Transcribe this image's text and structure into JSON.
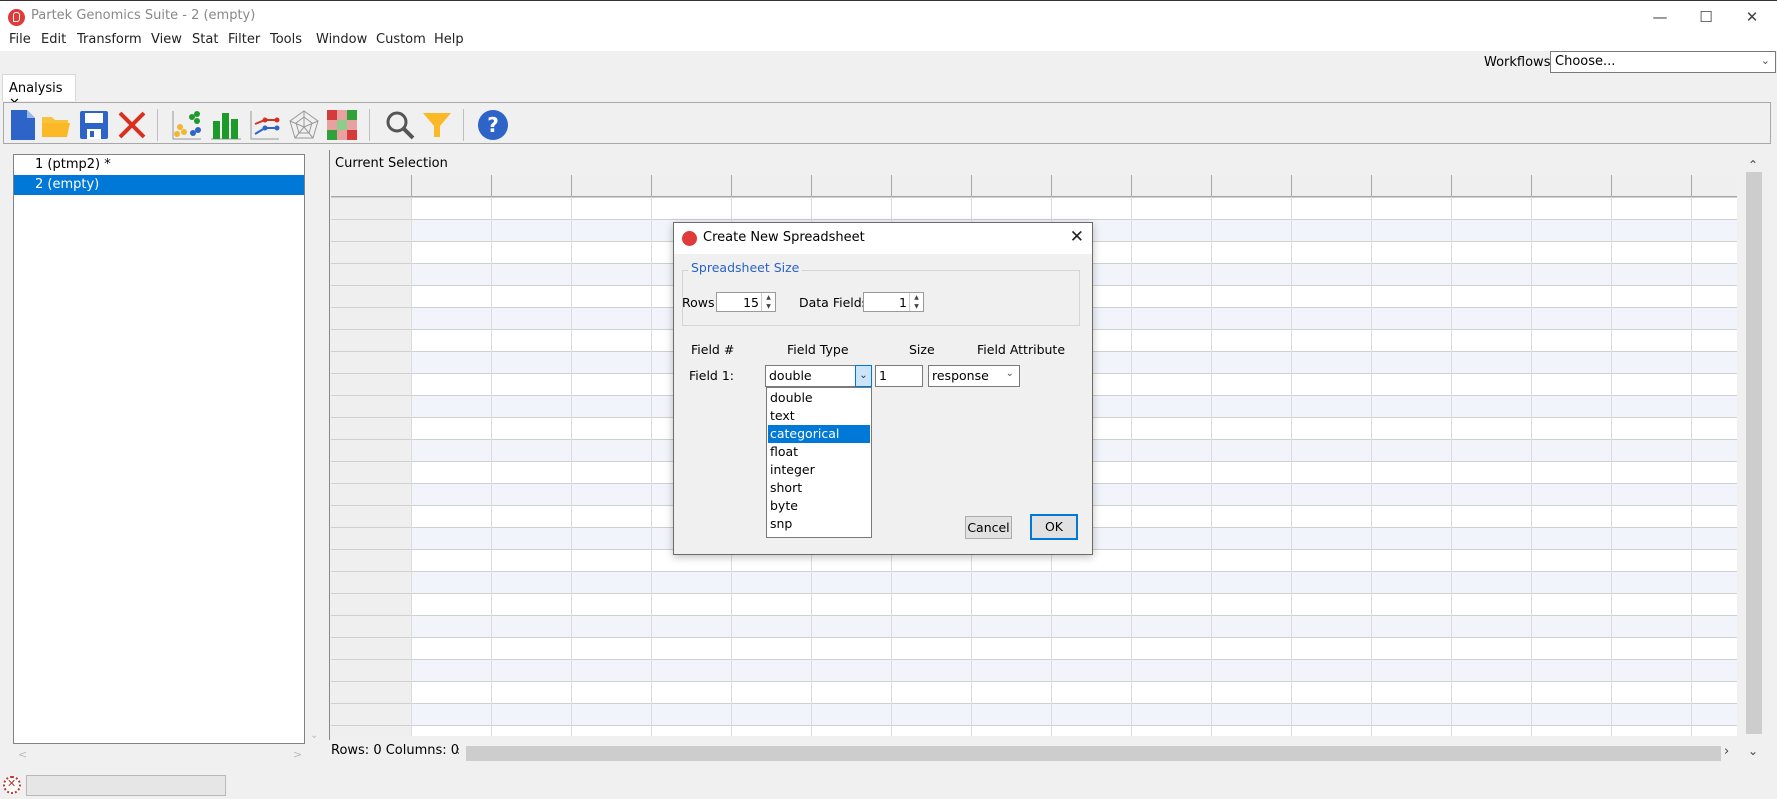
{
  "window": {
    "title": "Partek Genomics Suite - 2 (empty)",
    "controls": {
      "minimize": "—",
      "maximize": "☐",
      "close": "✕"
    }
  },
  "menubar": [
    "File",
    "Edit",
    "Transform",
    "View",
    "Stat",
    "Filter",
    "Tools",
    "Window",
    "Custom",
    "Help"
  ],
  "workflows": {
    "label": "Workflows",
    "selected": "Choose..."
  },
  "tab": {
    "label": "Analysis",
    "close": "✕"
  },
  "toolbar": {
    "icons": [
      "new-file-icon",
      "open-folder-icon",
      "save-icon",
      "delete-icon",
      "scatter-plot-icon",
      "bar-chart-icon",
      "line-chart-icon",
      "radar-chart-icon",
      "heatmap-icon",
      "search-icon",
      "filter-icon",
      "help-icon"
    ]
  },
  "spreadsheet_list": {
    "items": [
      {
        "label": "1 (ptmp2) *",
        "selected": false
      },
      {
        "label": "2 (empty)",
        "selected": true
      }
    ]
  },
  "grid": {
    "title": "Current Selection",
    "status": "Rows: 0 Columns: 0"
  },
  "colors": {
    "accent": "#0078d7",
    "group_title": "#2a62c9",
    "row_band": "#f1f5fb"
  },
  "dialog": {
    "title": "Create New Spreadsheet",
    "close": "✕",
    "group_title": "Spreadsheet Size",
    "rows_label": "Rows",
    "rows_value": "15",
    "data_fields_label": "Data Fields",
    "data_fields_value": "1",
    "headers": {
      "field_num": "Field #",
      "field_type": "Field Type",
      "size": "Size",
      "field_attribute": "Field Attribute"
    },
    "field_row": {
      "label": "Field 1:",
      "type": "double",
      "size": "1",
      "attribute": "response"
    },
    "type_options": [
      {
        "label": "double",
        "highlighted": false
      },
      {
        "label": "text",
        "highlighted": false
      },
      {
        "label": "categorical",
        "highlighted": true
      },
      {
        "label": "float",
        "highlighted": false
      },
      {
        "label": "integer",
        "highlighted": false
      },
      {
        "label": "short",
        "highlighted": false
      },
      {
        "label": "byte",
        "highlighted": false
      },
      {
        "label": "snp",
        "highlighted": false
      }
    ],
    "cancel_label": "Cancel",
    "ok_label": "OK"
  }
}
